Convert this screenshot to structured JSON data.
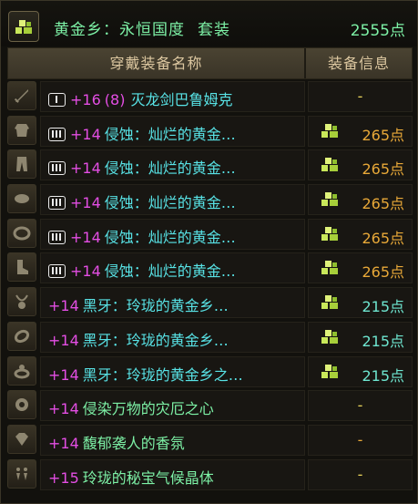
{
  "header": {
    "title": "黄金乡：永恒国度",
    "suffix": "套装",
    "points": "2555点",
    "icon": "gold-set-icon"
  },
  "columns": {
    "name": "穿戴装备名称",
    "info": "装备信息"
  },
  "rows": [
    {
      "slot_icon": "sword-icon",
      "badge": "I",
      "plus": "+16",
      "extra": "(8)",
      "name": "灭龙剑巴鲁姆克",
      "name_color": "cyan",
      "set_icon": false,
      "info": "-",
      "info_type": "dash-yellow"
    },
    {
      "slot_icon": "top-armor-icon",
      "badge": "III",
      "plus": "+14",
      "extra": "",
      "name": "侵蚀：灿烂的黄金…",
      "name_color": "cyan",
      "set_icon": true,
      "info": "265点",
      "info_type": "pts-orange"
    },
    {
      "slot_icon": "pants-icon",
      "badge": "III",
      "plus": "+14",
      "extra": "",
      "name": "侵蚀：灿烂的黄金…",
      "name_color": "cyan",
      "set_icon": true,
      "info": "265点",
      "info_type": "pts-orange"
    },
    {
      "slot_icon": "shoulder-icon",
      "badge": "III",
      "plus": "+14",
      "extra": "",
      "name": "侵蚀：灿烂的黄金…",
      "name_color": "cyan",
      "set_icon": true,
      "info": "265点",
      "info_type": "pts-orange"
    },
    {
      "slot_icon": "belt-icon",
      "badge": "III",
      "plus": "+14",
      "extra": "",
      "name": "侵蚀：灿烂的黄金…",
      "name_color": "cyan",
      "set_icon": true,
      "info": "265点",
      "info_type": "pts-orange"
    },
    {
      "slot_icon": "shoes-icon",
      "badge": "III",
      "plus": "+14",
      "extra": "",
      "name": "侵蚀：灿烂的黄金…",
      "name_color": "cyan",
      "set_icon": true,
      "info": "265点",
      "info_type": "pts-orange"
    },
    {
      "slot_icon": "necklace-icon",
      "badge": "",
      "plus": "+14",
      "extra": "",
      "name": "黑牙：玲珑的黄金乡…",
      "name_color": "cyan",
      "set_icon": true,
      "info": "215点",
      "info_type": "pts-teal"
    },
    {
      "slot_icon": "bracelet-icon",
      "badge": "",
      "plus": "+14",
      "extra": "",
      "name": "黑牙：玲珑的黄金乡…",
      "name_color": "cyan",
      "set_icon": true,
      "info": "215点",
      "info_type": "pts-teal"
    },
    {
      "slot_icon": "ring-icon",
      "badge": "",
      "plus": "+14",
      "extra": "",
      "name": "黑牙：玲珑的黄金乡之…",
      "name_color": "cyan",
      "set_icon": true,
      "info": "215点",
      "info_type": "pts-teal"
    },
    {
      "slot_icon": "support-icon",
      "badge": "",
      "plus": "+14",
      "extra": "",
      "name": "侵染万物的灾厄之心",
      "name_color": "green",
      "set_icon": false,
      "info": "-",
      "info_type": "dash-yellow"
    },
    {
      "slot_icon": "magic-stone-icon",
      "badge": "",
      "plus": "+14",
      "extra": "",
      "name": "馥郁袭人的香氛",
      "name_color": "green",
      "set_icon": false,
      "info": "-",
      "info_type": "dash-orange"
    },
    {
      "slot_icon": "earring-icon",
      "badge": "",
      "plus": "+15",
      "extra": "",
      "name": "玲珑的秘宝气候晶体",
      "name_color": "green",
      "set_icon": false,
      "info": "-",
      "info_type": "dash-yellow"
    }
  ],
  "colors": {
    "title_green": "#7df1a6",
    "item_cyan": "#58e3e6",
    "plus_magenta": "#e44ee4",
    "points_orange": "#e8a838",
    "points_teal": "#6ee6d0"
  }
}
